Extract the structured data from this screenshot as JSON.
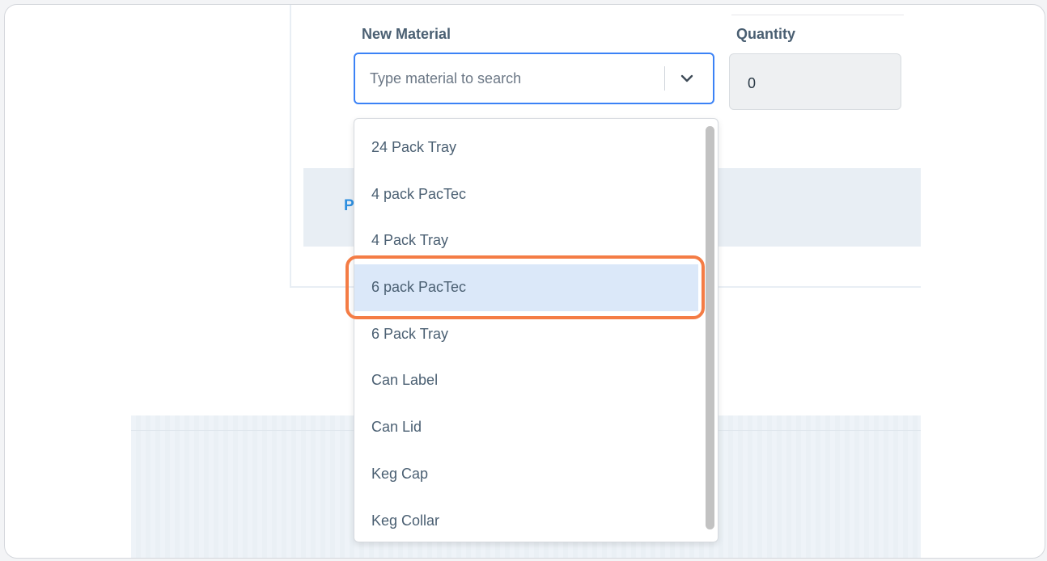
{
  "form": {
    "new_material_label": "New Material",
    "quantity_label": "Quantity",
    "material_select": {
      "placeholder": "Type material to search",
      "expanded": true
    },
    "quantity_value": "0"
  },
  "background": {
    "partial_label_letter": "P"
  },
  "dropdown": {
    "highlighted_index": 3,
    "options": [
      "24 Pack Tray",
      "4 pack PacTec",
      "4 Pack Tray",
      "6 pack PacTec",
      "6 Pack Tray",
      "Can Label",
      "Can Lid",
      "Keg Cap",
      "Keg Collar"
    ]
  },
  "colors": {
    "focus_border": "#3b82f6",
    "highlight_ring": "#f47c45",
    "option_highlight": "#dbe8f9",
    "label_text": "#4a5f72"
  },
  "icons": {
    "select_indicator": "chevron-down-icon"
  }
}
